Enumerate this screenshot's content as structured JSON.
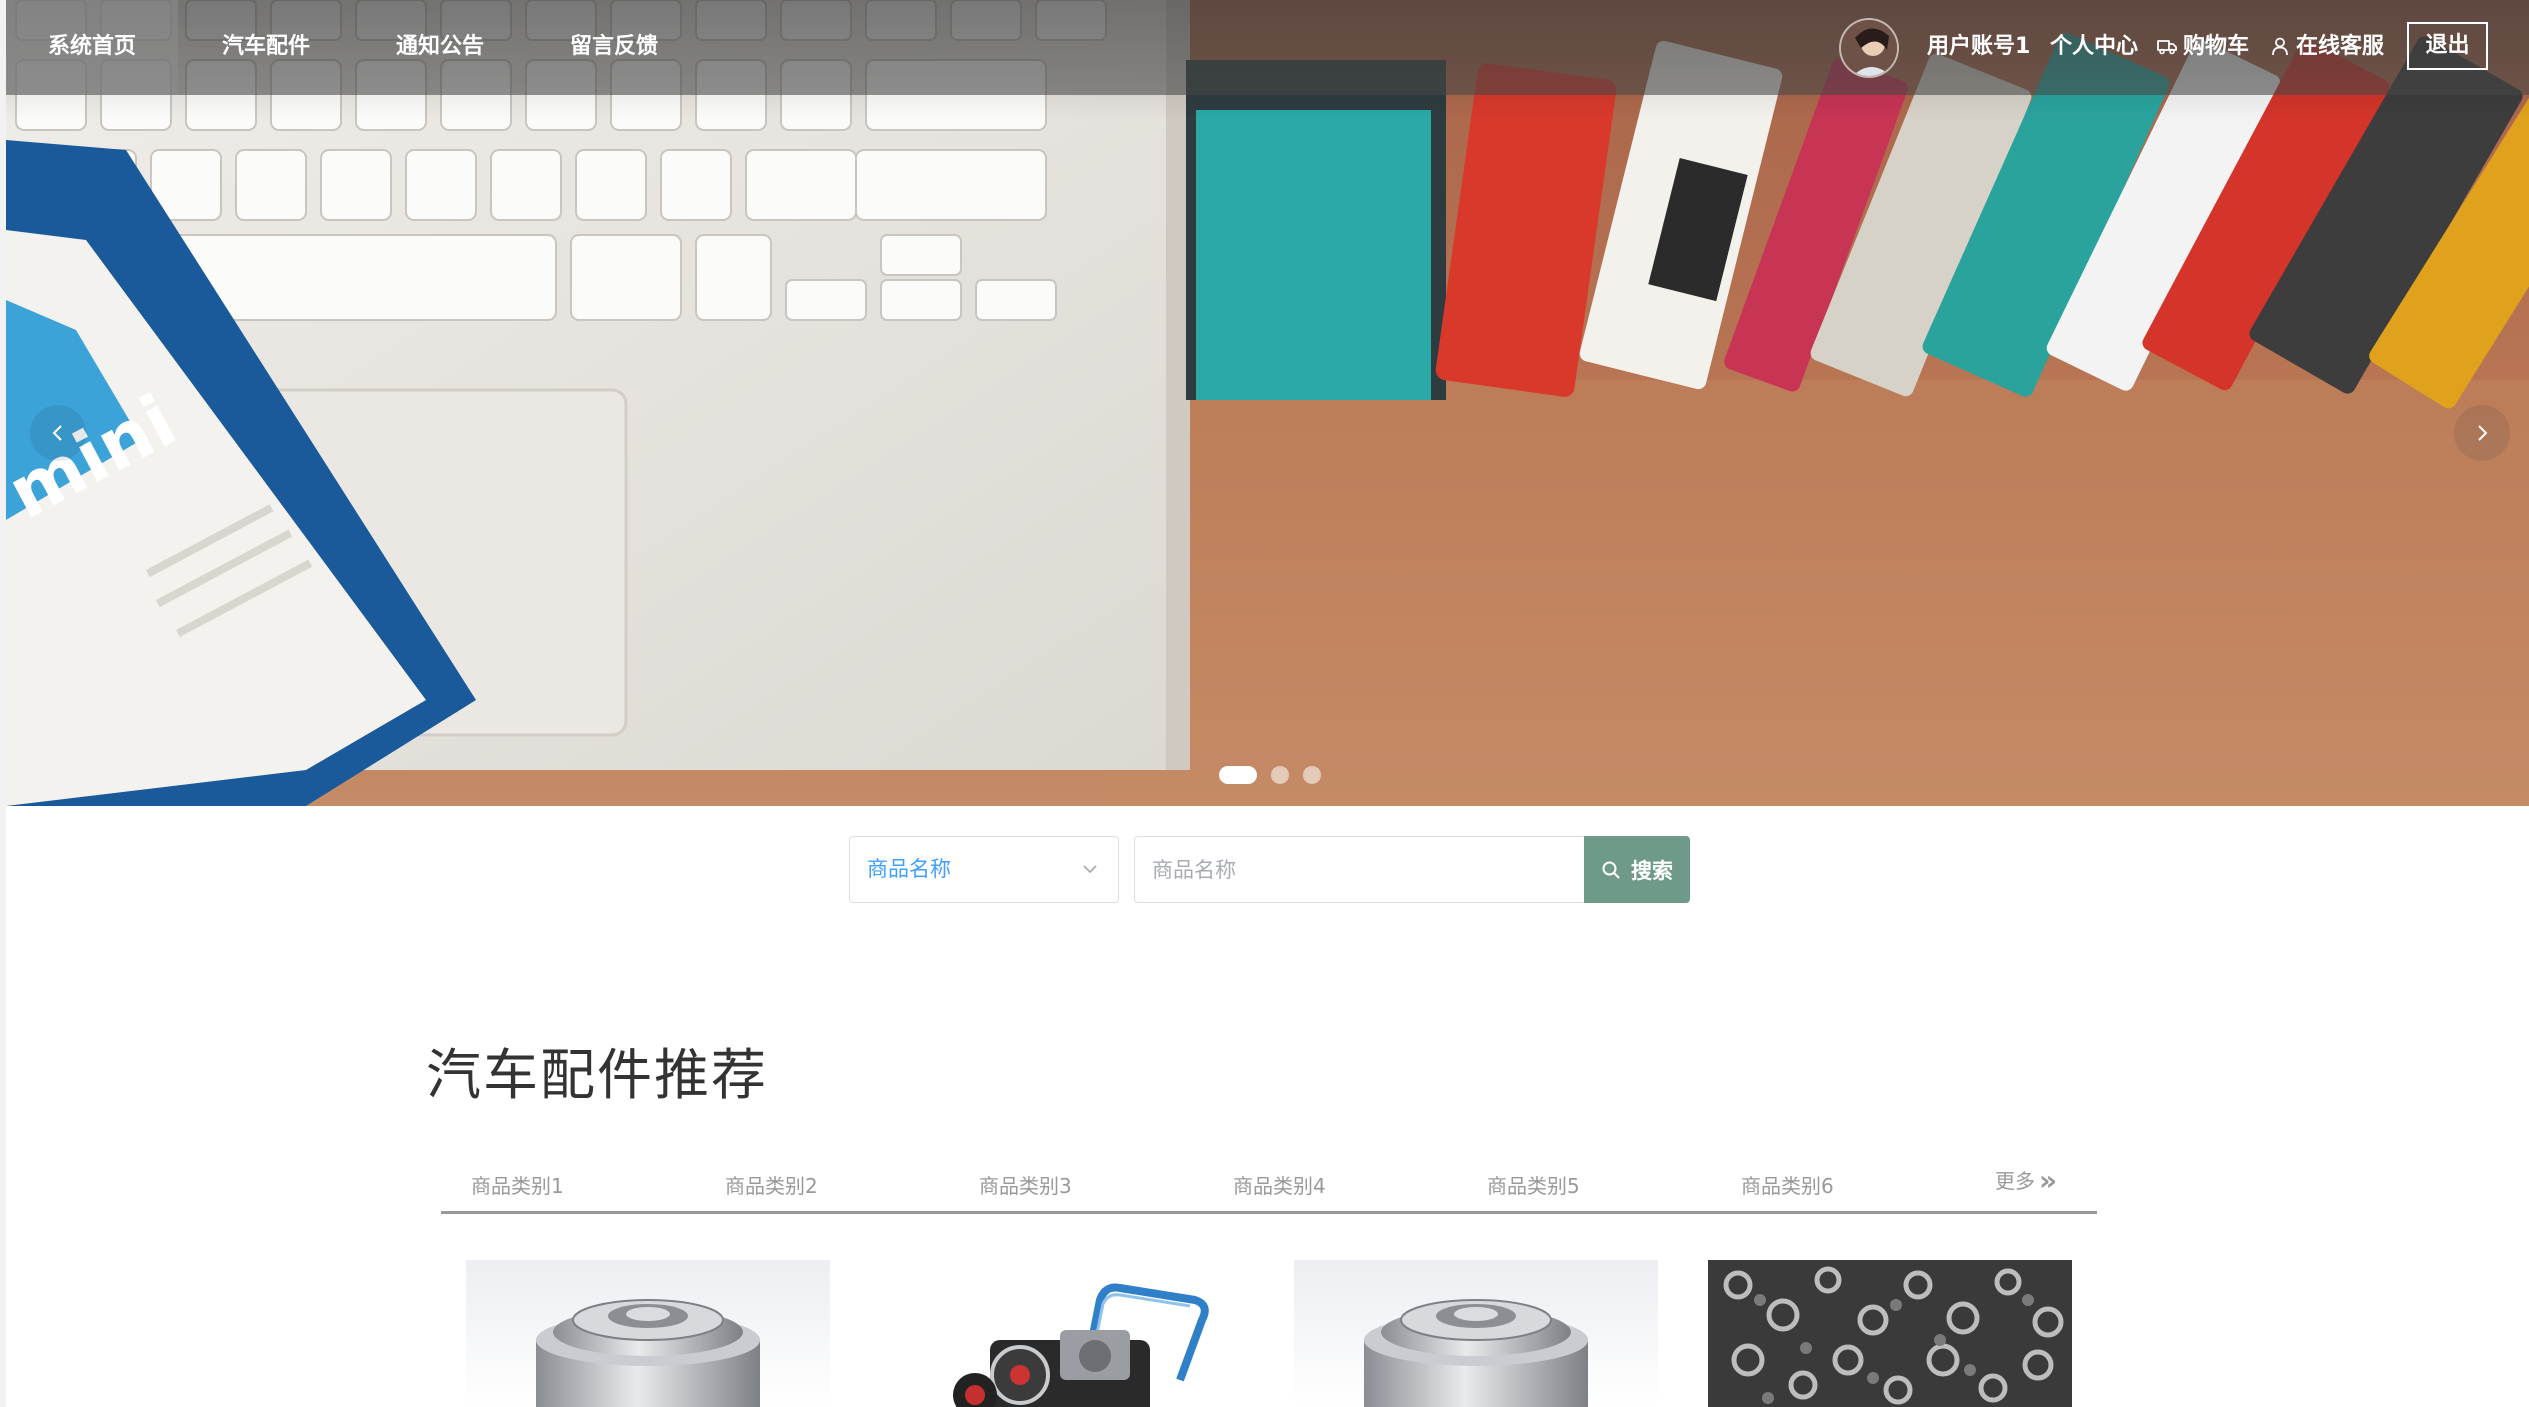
{
  "nav": {
    "items": [
      {
        "label": "系统首页",
        "active": true
      },
      {
        "label": "汽车配件",
        "active": false
      },
      {
        "label": "通知公告",
        "active": false
      },
      {
        "label": "留言反馈",
        "active": false
      }
    ]
  },
  "user": {
    "account": "用户账号1",
    "personal_center": "个人中心",
    "cart": "购物车",
    "service": "在线客服",
    "logout": "退出"
  },
  "carousel": {
    "slide_count": 3,
    "active_index": 0,
    "prev_icon": "chevron-left-icon",
    "next_icon": "chevron-right-icon"
  },
  "search": {
    "field_select_value": "商品名称",
    "input_placeholder": "商品名称",
    "button_label": "搜索",
    "button_color": "#6f9a89",
    "select_text_color": "#409eff"
  },
  "section": {
    "title": "汽车配件推荐",
    "categories": [
      "商品类别1",
      "商品类别2",
      "商品类别3",
      "商品类别4",
      "商品类别5",
      "商品类别6"
    ],
    "more_label": "更多",
    "more_icon": "double-chevron-right-icon"
  },
  "products": [
    {
      "image": "wheel-hub-bearing"
    },
    {
      "image": "engine-cart"
    },
    {
      "image": "wheel-hub-bearing"
    },
    {
      "image": "metal-parts-pile"
    }
  ]
}
